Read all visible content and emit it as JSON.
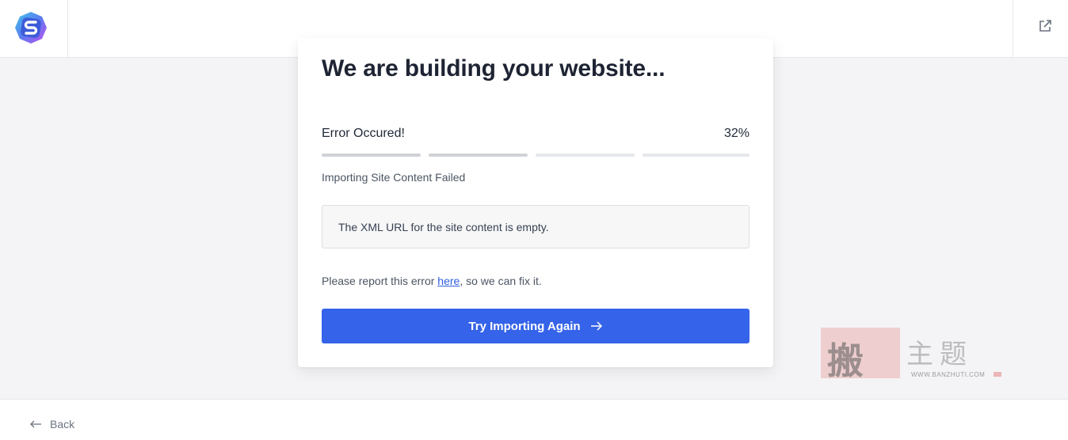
{
  "header": {
    "logo_icon": "starter-templates-logo-icon",
    "external_link_icon": "external-link-icon"
  },
  "card": {
    "title": "We are building your website...",
    "status": "Error Occured!",
    "percent": "32%",
    "progress_segments": 4,
    "progress_completed_segments": 2,
    "sub_status": "Importing Site Content Failed",
    "error_message": "The XML URL for the site content is empty.",
    "report_prefix": "Please report this error ",
    "report_link": "here",
    "report_suffix": ", so we can fix it.",
    "button_label": "Try Importing Again",
    "button_icon": "arrow-right-icon",
    "accent_color": "#3563e9"
  },
  "footer": {
    "back_label": "Back",
    "back_icon": "arrow-left-icon"
  },
  "watermark": {
    "stamp": "搬",
    "title": "主题",
    "url": "WWW.BANZHUTI.COM"
  }
}
